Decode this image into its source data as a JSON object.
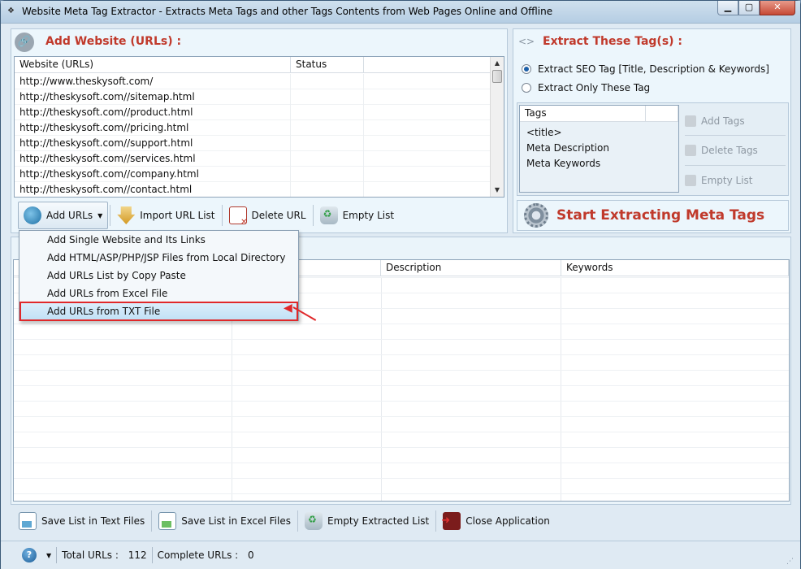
{
  "window": {
    "title": "Website Meta Tag Extractor - Extracts Meta Tags and other Tags Contents from Web Pages Online and Offline",
    "controls": {
      "minimize": "▁",
      "maximize": "▢",
      "close": "✕"
    }
  },
  "add_website": {
    "title": "Add Website (URLs) :",
    "columns": [
      "Website (URLs)",
      "Status",
      ""
    ],
    "rows": [
      "http://www.theskysoft.com/",
      "http://theskysoft.com//sitemap.html",
      "http://theskysoft.com//product.html",
      "http://theskysoft.com//pricing.html",
      "http://theskysoft.com//support.html",
      "http://theskysoft.com//services.html",
      "http://theskysoft.com//company.html",
      "http://theskysoft.com//contact.html"
    ],
    "toolbar": {
      "add_urls": "Add URLs",
      "import_url_list": "Import URL List",
      "delete_url": "Delete URL",
      "empty_list": "Empty List"
    }
  },
  "add_urls_menu": {
    "items": [
      "Add Single Website and Its Links",
      "Add HTML/ASP/PHP/JSP Files from Local Directory",
      "Add URLs List by Copy Paste",
      "Add URLs from Excel File",
      "Add URLs from TXT File"
    ],
    "highlighted_index": 4
  },
  "extract_tags": {
    "title": "Extract These Tag(s) :",
    "options": [
      {
        "label": "Extract SEO Tag [Title, Description & Keywords]",
        "selected": true
      },
      {
        "label": "Extract Only These Tag",
        "selected": false
      }
    ],
    "tags_header": "Tags",
    "tags": [
      "<title>",
      "Meta Description",
      "Meta Keywords"
    ],
    "add_tags": "Add Tags",
    "delete_tags": "Delete Tags",
    "empty_list": "Empty List",
    "start_button": "Start Extracting Meta Tags"
  },
  "results": {
    "columns": [
      "",
      "Description",
      "Keywords"
    ]
  },
  "bottom_toolbar": {
    "save_text": "Save List in Text Files",
    "save_excel": "Save List in Excel Files",
    "empty_extracted": "Empty Extracted List",
    "close_app": "Close Application"
  },
  "status": {
    "help": "?",
    "total_urls_label": "Total URLs :",
    "total_urls": "112",
    "complete_urls_label": "Complete URLs :",
    "complete_urls": "0"
  },
  "colors": {
    "accent_red": "#c0392b",
    "highlight_border": "#e0282a",
    "panel_bg": "#ecf6fc"
  }
}
